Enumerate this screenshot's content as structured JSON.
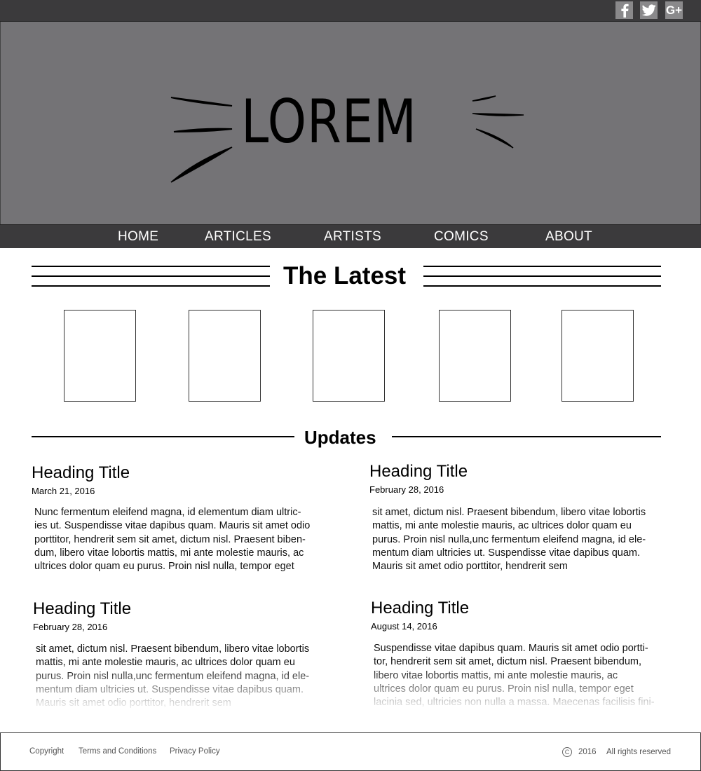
{
  "social": {
    "facebook_icon": "facebook-icon",
    "twitter_icon": "twitter-icon",
    "googleplus_label": "G+"
  },
  "hero": {
    "logo": "LOREM"
  },
  "nav": {
    "items": [
      {
        "label": "HOME"
      },
      {
        "label": "ARTICLES"
      },
      {
        "label": "ARTISTS"
      },
      {
        "label": "COMICS"
      },
      {
        "label": "ABOUT"
      }
    ]
  },
  "latest": {
    "title": "The Latest",
    "thumb_count": 5
  },
  "updates": {
    "title": "Updates",
    "posts": [
      {
        "heading": "Heading Title",
        "date": "March 21, 2016",
        "body": "Nunc fermentum eleifend magna, id elementum diam ultric-\nies ut. Suspendisse vitae dapibus quam. Mauris sit amet odio\nporttitor, hendrerit sem sit amet, dictum nisl. Praesent biben-\ndum, libero vitae lobortis mattis, mi ante molestie mauris, ac\nultrices dolor quam eu purus. Proin nisl nulla, tempor eget"
      },
      {
        "heading": "Heading Title",
        "date": "February 28, 2016",
        "body": " sit amet, dictum nisl. Praesent bibendum, libero vitae lobortis\nmattis, mi ante molestie mauris, ac ultrices dolor quam eu\npurus. Proin nisl nulla,unc fermentum eleifend magna, id ele-\nmentum diam ultricies ut. Suspendisse vitae dapibus quam.\nMauris sit amet odio porttitor, hendrerit sem"
      },
      {
        "heading": "Heading Title",
        "date": "February 28, 2016",
        "body": " sit amet, dictum nisl. Praesent bibendum, libero vitae lobortis\nmattis, mi ante molestie mauris, ac ultrices dolor quam eu\npurus. Proin nisl nulla,unc fermentum eleifend magna, id ele-\nmentum diam ultricies ut. Suspendisse vitae dapibus quam.\nMauris sit amet odio porttitor, hendrerit sem"
      },
      {
        "heading": "Heading Title",
        "date": "August 14, 2016",
        "body": "Suspendisse vitae dapibus quam. Mauris sit amet odio portti-\ntor, hendrerit sem sit amet, dictum nisl. Praesent bibendum,\nlibero vitae lobortis mattis, mi ante molestie mauris, ac\nultrices dolor quam eu purus. Proin nisl nulla, tempor eget\nlacinia sed, ultricies non nulla a massa. Maecenas facilisis fini-"
      }
    ]
  },
  "footer": {
    "copyright": "Copyright",
    "terms": "Terms and Conditions",
    "privacy": "Privacy Policy",
    "copyright_symbol": "C",
    "year": "2016",
    "rights": "All rights reserved"
  },
  "colors": {
    "bar": "#3b3a3c",
    "hero": "#747376",
    "social_tile": "#8a898b"
  }
}
